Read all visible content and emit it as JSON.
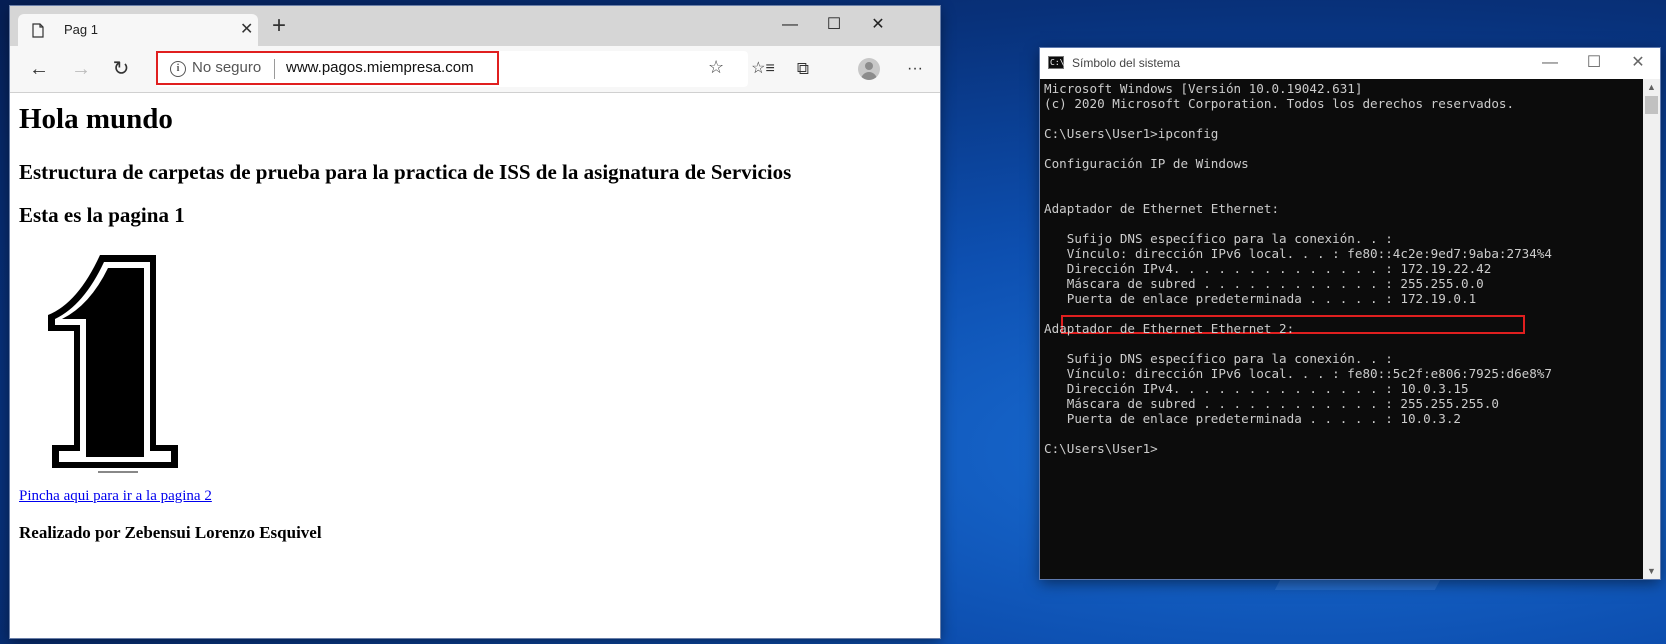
{
  "browser": {
    "tab": {
      "title": "Pag 1",
      "icon": "page-icon"
    },
    "window_controls": {
      "minimize": "—",
      "maximize": "☐",
      "close": "✕"
    },
    "toolbar": {
      "back": "←",
      "forward": "→",
      "refresh": "↻",
      "security": "No seguro",
      "url": "www.pagos.miempresa.com",
      "favorite": "☆",
      "favorites": "☆≡",
      "collections": "⧉",
      "more": "···"
    },
    "page": {
      "heading": "Hola mundo",
      "subheading": "Estructura de carpetas de prueba para la practica de ISS de la asignatura de Servicios",
      "page_title": "Esta es la pagina 1",
      "image_alt": "number-one-image",
      "link": "Pincha aqui para ir a la pagina 2",
      "author": "Realizado por Zebensui Lorenzo Esquivel"
    }
  },
  "console": {
    "title": "Símbolo del sistema",
    "icon_text": "C:\\",
    "window_controls": {
      "minimize": "—",
      "maximize": "☐",
      "close": "✕"
    },
    "lines": [
      "Microsoft Windows [Versión 10.0.19042.631]",
      "(c) 2020 Microsoft Corporation. Todos los derechos reservados.",
      "",
      "C:\\Users\\User1>ipconfig",
      "",
      "Configuración IP de Windows",
      "",
      "",
      "Adaptador de Ethernet Ethernet:",
      "",
      "   Sufijo DNS específico para la conexión. . :",
      "   Vínculo: dirección IPv6 local. . . : fe80::4c2e:9ed7:9aba:2734%4",
      "   Dirección IPv4. . . . . . . . . . . . . . : 172.19.22.42",
      "   Máscara de subred . . . . . . . . . . . . : 255.255.0.0",
      "   Puerta de enlace predeterminada . . . . . : 172.19.0.1",
      "",
      "Adaptador de Ethernet Ethernet 2:",
      "",
      "   Sufijo DNS específico para la conexión. . :",
      "   Vínculo: dirección IPv6 local. . . : fe80::5c2f:e806:7925:d6e8%7",
      "   Dirección IPv4. . . . . . . . . . . . . . : 10.0.3.15",
      "   Máscara de subred . . . . . . . . . . . . : 255.255.255.0",
      "   Puerta de enlace predeterminada . . . . . : 10.0.3.2",
      "",
      "C:\\Users\\User1>"
    ]
  }
}
